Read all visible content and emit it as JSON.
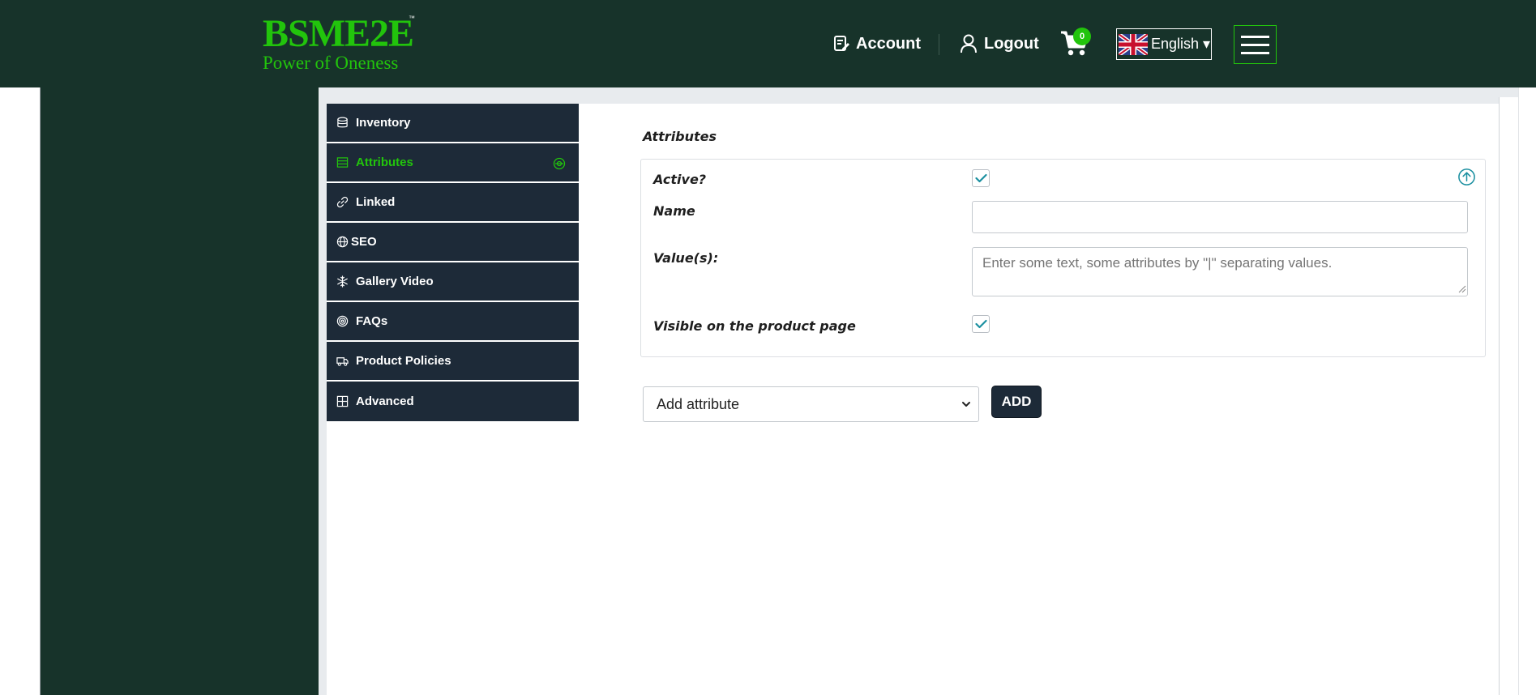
{
  "brand": {
    "name": "BSME2E",
    "tagline": "Power of Oneness",
    "trademark": "™"
  },
  "header": {
    "account_label": "Account",
    "logout_label": "Logout",
    "cart_count": "0",
    "language": "English ▾",
    "icons": [
      "account-icon",
      "user-icon",
      "cart-icon",
      "uk-flag-icon",
      "hamburger-menu-icon"
    ]
  },
  "tabs": [
    {
      "label": "Inventory",
      "icon": "database-icon"
    },
    {
      "label": "Attributes",
      "icon": "list-icon",
      "active": true
    },
    {
      "label": "Linked",
      "icon": "link-icon"
    },
    {
      "label": "SEO",
      "icon": "globe-icon"
    },
    {
      "label": "Gallery Video",
      "icon": "snowflake-icon"
    },
    {
      "label": "FAQs",
      "icon": "target-icon"
    },
    {
      "label": "Product Policies",
      "icon": "truck-icon"
    },
    {
      "label": "Advanced",
      "icon": "grid-icon"
    }
  ],
  "attributes": {
    "title": "Attributes",
    "active_label": "Active?",
    "active_checked": true,
    "name_label": "Name",
    "name_value": "",
    "values_label": "Value(s):",
    "values_placeholder": "Enter some text, some attributes by \"|\" separating values.",
    "visible_label": "Visible on the product page",
    "visible_checked": true
  },
  "add_attribute": {
    "select_value": "Add attribute",
    "button_label": "ADD"
  },
  "colors": {
    "header_bg": "#17332a",
    "brand_green": "#22c40c",
    "tab_bg": "#1d2a38",
    "check_teal": "#1a8fa0"
  }
}
